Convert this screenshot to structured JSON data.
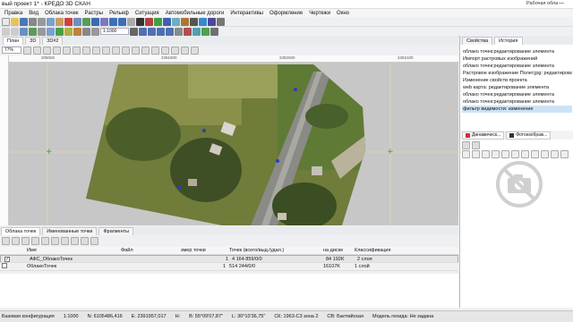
{
  "title_bar": {
    "title": "вый проект 1* - КРЕДО 3D СКАН",
    "workspace": "Рабочая обла"
  },
  "menu": [
    "Правка",
    "Вид",
    "Облака точек",
    "Растры",
    "Рельеф",
    "Ситуация",
    "Автомобильные дороги",
    "Интерактивы",
    "Оформление",
    "Чертежи",
    "Окно"
  ],
  "scale_select": "1:1000",
  "view_tabs": [
    "План",
    "3D",
    "3D#2"
  ],
  "zoom_select": "77%",
  "ruler_labels": [
    "209000",
    "2391900",
    "2392000",
    "2392100"
  ],
  "panel_tabs": {
    "properties": "Свойства",
    "history": "История"
  },
  "history": [
    "облако точек:редактирование элемента",
    "Импорт растровых изображений",
    "облако точек:редактирование элемента",
    "Растровое изображение Полет.jpg: редактирование",
    "Изменение свойств проекта",
    "web карта: редактирование элемента",
    "облако точек:редактирование элемента",
    "облако точек:редактирование элемента",
    "фильтр видимости: изменение"
  ],
  "panel_subtabs": {
    "dynamic": "Динамическ...",
    "photo": "Фотоизображ..."
  },
  "bottom_tabs": [
    "Облака точек",
    "Именованные точки",
    "Фрагменты"
  ],
  "table": {
    "headers": [
      "Имя",
      "Файл",
      "змер точки",
      "Точек (всего/выд./удал.)",
      "на диске",
      "Классификация"
    ],
    "rows": [
      {
        "checked": true,
        "name": "АФС_ОблакоТочек",
        "file": "",
        "size": "1",
        "points": "4 164 859/0/0",
        "disk": "84 192K",
        "classes": "2 слоя"
      },
      {
        "checked": false,
        "name": "ОблакоТочек",
        "file": "",
        "size": "1",
        "points": "514 244/0/0",
        "disk": "16107K",
        "classes": "1 слой"
      }
    ]
  },
  "status": {
    "config": "Базовая конфигурация",
    "scale": "1:1000",
    "north": "N: 6105486,416",
    "east": "E: 2391957,017",
    "h": "H:",
    "lat": "B: 55°09'07,87\"",
    "lon": "L: 30°10'36,75\"",
    "cs": "СК: 1963-С3 зона 2",
    "height_system": "СВ: Балтийская",
    "geoid": "Модель геоида: Не задана"
  },
  "colors": {
    "accent": "#2a62b0",
    "history_selected": "#cde3f5",
    "canvas": "#c7c7c7"
  }
}
